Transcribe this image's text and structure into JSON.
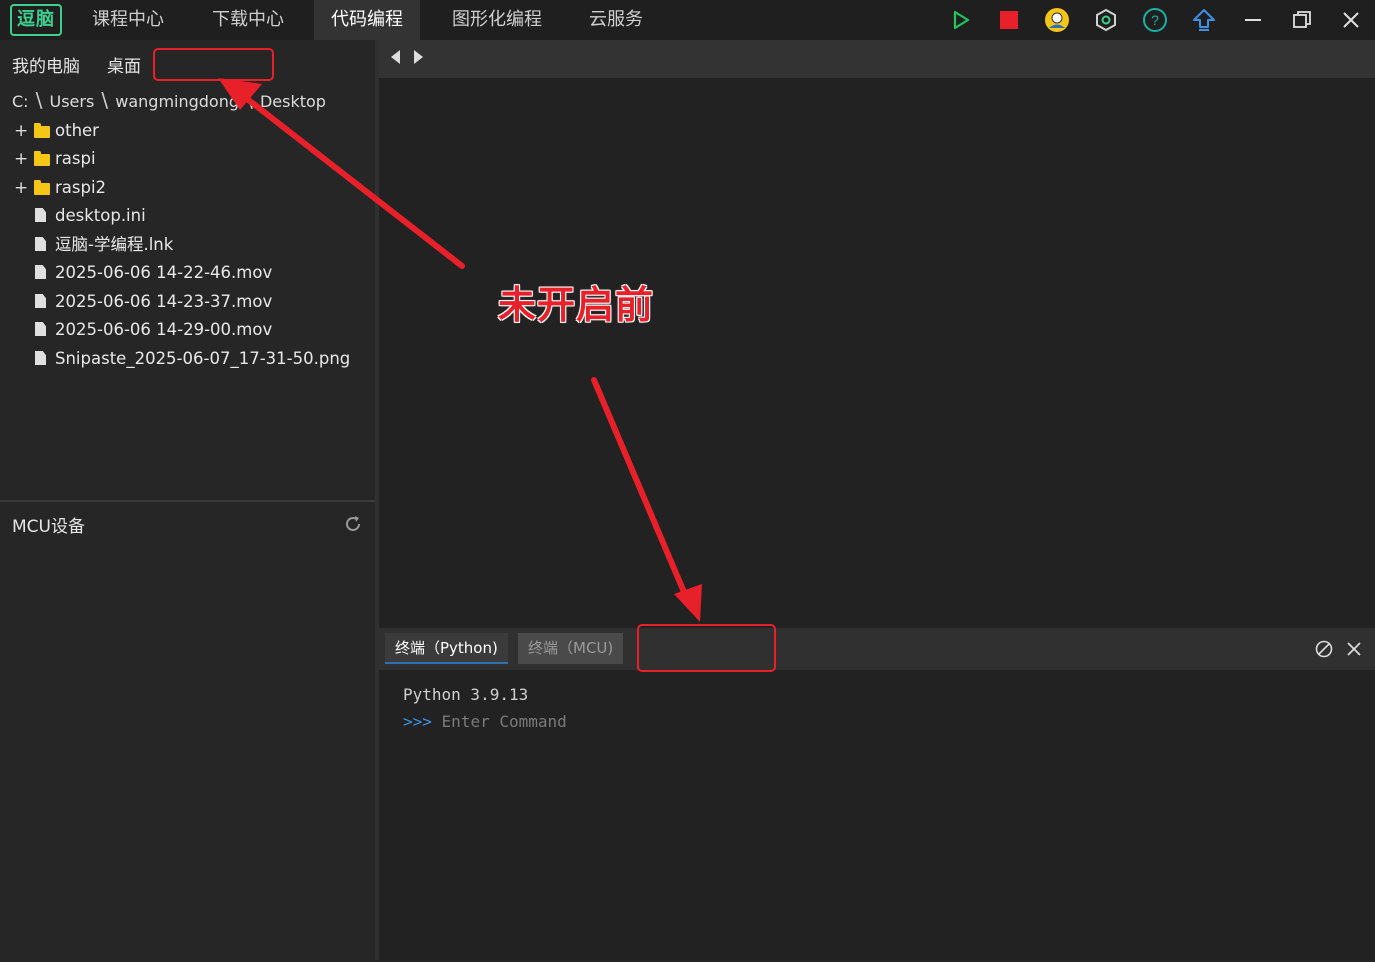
{
  "app": {
    "logo_text": "逗脑"
  },
  "nav": [
    {
      "label": "课程中心"
    },
    {
      "label": "下载中心"
    },
    {
      "label": "代码编程"
    },
    {
      "label": "图形化编程"
    },
    {
      "label": "云服务"
    }
  ],
  "toolbar_icons": [
    "run-icon",
    "stop-icon",
    "user-avatar-icon",
    "settings-hex-icon",
    "help-icon",
    "upload-icon",
    "minimize-icon",
    "restore-icon",
    "close-icon"
  ],
  "colors": {
    "accent_green": "#3ecf8e",
    "run_green": "#22c55e",
    "stop_red": "#e8202a",
    "annotation_red": "#e8202a",
    "tab_blue": "#2f6fb3"
  },
  "explorer": {
    "tabs": [
      "我的电脑",
      "桌面"
    ],
    "path": [
      "C:",
      "Users",
      "wangmingdong",
      "Desktop"
    ],
    "path_sep": "\\",
    "items": [
      {
        "type": "folder",
        "name": "other"
      },
      {
        "type": "folder",
        "name": "raspi"
      },
      {
        "type": "folder",
        "name": "raspi2"
      },
      {
        "type": "file",
        "name": "desktop.ini"
      },
      {
        "type": "file",
        "name": "逗脑-学编程.lnk"
      },
      {
        "type": "file",
        "name": "2025-06-06 14-22-46.mov"
      },
      {
        "type": "file",
        "name": "2025-06-06 14-23-37.mov"
      },
      {
        "type": "file",
        "name": "2025-06-06 14-29-00.mov"
      },
      {
        "type": "file",
        "name": "Snipaste_2025-06-07_17-31-50.png"
      }
    ]
  },
  "mcu": {
    "title": "MCU设备"
  },
  "terminal": {
    "tabs": [
      {
        "label": "终端（Python)"
      },
      {
        "label": "终端（MCU)"
      }
    ],
    "version_line": "Python 3.9.13",
    "prompt": ">>>",
    "placeholder": "Enter Command"
  },
  "annotation": {
    "text": "未开启前"
  }
}
